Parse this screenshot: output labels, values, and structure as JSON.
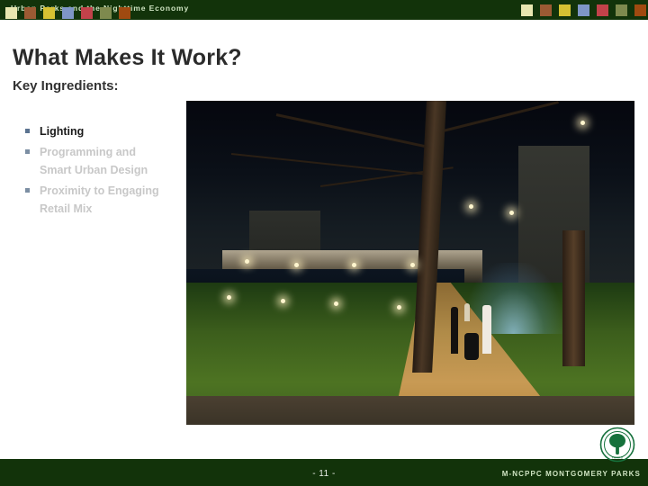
{
  "header": {
    "title": "Urban Parks and the Nighttime Economy",
    "bar_color": "#12330a",
    "swatches": [
      {
        "name": "swatch-cream",
        "color": "#e8e6b0"
      },
      {
        "name": "swatch-brown",
        "color": "#9c5a33"
      },
      {
        "name": "swatch-gold",
        "color": "#d6c132"
      },
      {
        "name": "swatch-blue",
        "color": "#7e96c6"
      },
      {
        "name": "swatch-red",
        "color": "#c2424a"
      },
      {
        "name": "swatch-olive",
        "color": "#7e8a4e"
      },
      {
        "name": "swatch-rust",
        "color": "#a04a10"
      }
    ]
  },
  "slide": {
    "title": "What Makes It Work?",
    "subtitle": "Key Ingredients:",
    "bullets": [
      {
        "text": "Lighting",
        "style": "emphasis"
      },
      {
        "text": "Programming and Smart Urban Design",
        "style": "dim"
      },
      {
        "text": "Proximity to Engaging Retail Mix",
        "style": "dim"
      }
    ]
  },
  "photo": {
    "alt": "Nighttime urban park with illuminated pavilion, reflecting pool, fountain, lawn and a family walking a stroller along a lit path",
    "caption": ""
  },
  "footer": {
    "page_number": "- 11 -",
    "organization": "M-NCPPC MONTGOMERY PARKS",
    "bar_color": "#12330a",
    "logo_name": "montgomery-parks-tree-seal",
    "logo_color": "#16713c",
    "swatches": [
      {
        "name": "swatch-cream",
        "color": "#e8e6b0"
      },
      {
        "name": "swatch-brown",
        "color": "#9c5a33"
      },
      {
        "name": "swatch-gold",
        "color": "#d6c132"
      },
      {
        "name": "swatch-blue",
        "color": "#7e96c6"
      },
      {
        "name": "swatch-red",
        "color": "#c2424a"
      },
      {
        "name": "swatch-olive",
        "color": "#7e8a4e"
      },
      {
        "name": "swatch-rust",
        "color": "#a04a10"
      }
    ]
  }
}
